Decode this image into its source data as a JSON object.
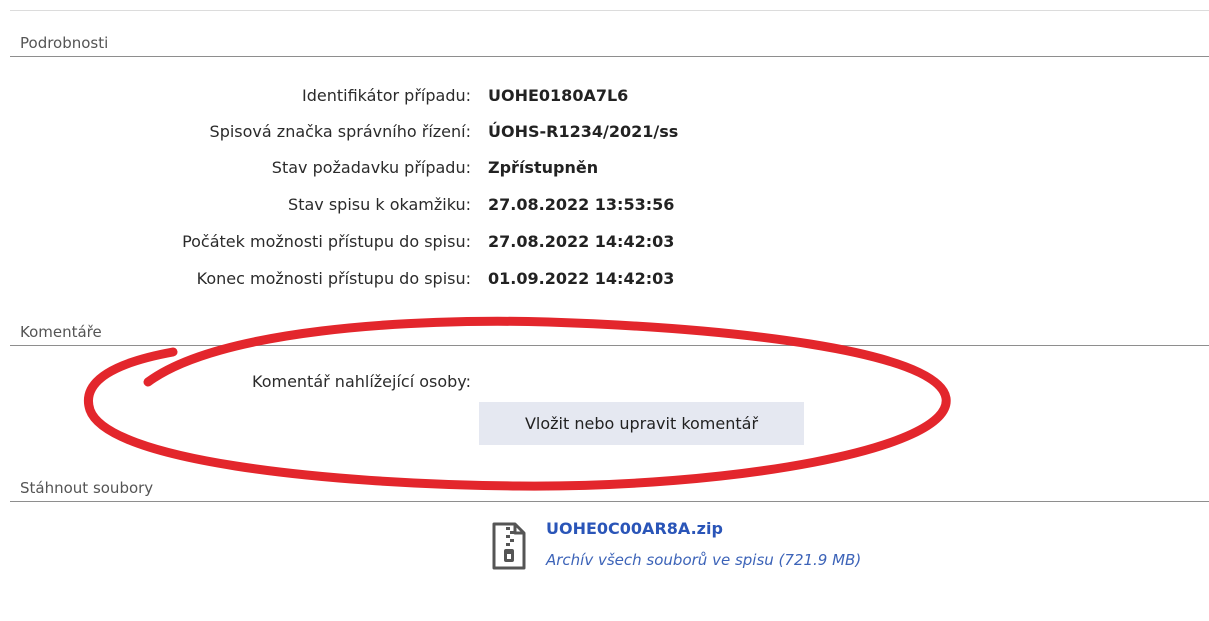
{
  "sections": {
    "details_title": "Podrobnosti",
    "comments_title": "Komentáře",
    "download_title": "Stáhnout soubory"
  },
  "details": [
    {
      "label": "Identifikátor případu:",
      "value": "UOHE0180A7L6"
    },
    {
      "label": "Spisová značka správního řízení:",
      "value": "ÚOHS-R1234/2021/ss"
    },
    {
      "label": "Stav požadavku případu:",
      "value": "Zpřístupněn"
    },
    {
      "label": "Stav spisu k okamžiku:",
      "value": "27.08.2022 13:53:56"
    },
    {
      "label": "Počátek možnosti přístupu do spisu:",
      "value": "27.08.2022 14:42:03"
    },
    {
      "label": "Konec možnosti přístupu do spisu:",
      "value": "01.09.2022 14:42:03"
    }
  ],
  "comments": {
    "label": "Komentář nahlížející osoby:",
    "button_label": "Vložit nebo upravit komentář"
  },
  "download": {
    "file_name": "UOHE0C00AR8A.zip",
    "description": "Archív všech souborů ve spisu (721.9 MB)",
    "icon": "zip-file-icon"
  },
  "colors": {
    "link": "#2a55b8",
    "button_bg": "#e5e8f1",
    "highlight": "#e3262c"
  }
}
